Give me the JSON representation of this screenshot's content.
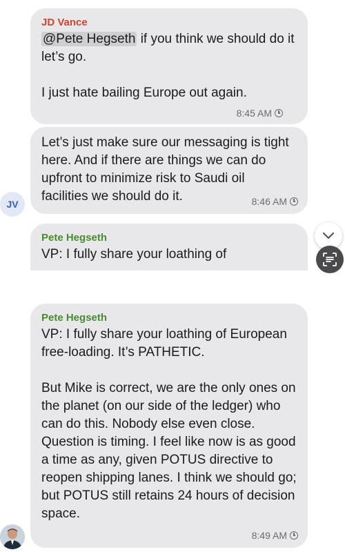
{
  "messages": [
    {
      "sender": "JD Vance",
      "sender_color": "#d0452f",
      "mention": "@Pete Hegseth",
      "text": " if you think we should do it let’s go.\n\nI just hate bailing Europe out again.",
      "time": "8:45 AM"
    },
    {
      "text": "Let’s just make sure our messaging is tight here. And if there are things we can do upfront to minimize risk to Saudi oil facilities we should do it.",
      "time": "8:46 AM"
    },
    {
      "sender": "Pete Hegseth",
      "sender_color": "#4a8a2f",
      "text": "VP: I fully share your loathing of"
    },
    {
      "sender": "Pete Hegseth",
      "sender_color": "#4a8a2f",
      "text": "VP: I fully share your loathing of European free-loading. It’s PATHETIC.\n\nBut Mike is correct, we are the only ones on the planet (on our side of the ledger) who can do this. Nobody else even close. Question is timing. I feel like now is as good a time as any, given POTUS directive to reopen shipping lanes. I think we should go; but POTUS still retains 24 hours of decision space.",
      "time": "8:49 AM"
    }
  ],
  "avatars": {
    "jv_initials": "JV"
  },
  "icons": {
    "scroll_down": "chevron-down-icon",
    "scan_text": "scan-text-icon"
  }
}
